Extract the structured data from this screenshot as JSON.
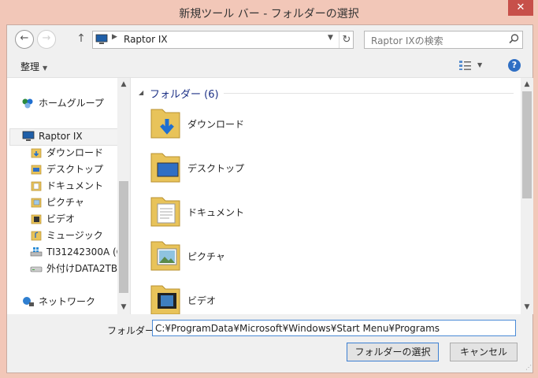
{
  "window": {
    "title": "新規ツール バー - フォルダーの選択",
    "close_label": "✕"
  },
  "nav": {
    "back_label": "←",
    "forward_label": "→",
    "up_label": "↑",
    "address": "Raptor IX",
    "search_placeholder": "Raptor IXの検索"
  },
  "toolbar": {
    "organize_label": "整理"
  },
  "sidebar": {
    "homegroup": "ホームグループ",
    "computer": "Raptor IX",
    "items": [
      "ダウンロード",
      "デスクトップ",
      "ドキュメント",
      "ピクチャ",
      "ビデオ",
      "ミュージック",
      "TI31242300A (C",
      "外付けDATA2TB"
    ],
    "network": "ネットワーク"
  },
  "content": {
    "group_label": "フォルダー (6)",
    "items": [
      "ダウンロード",
      "デスクトップ",
      "ドキュメント",
      "ピクチャ",
      "ビデオ"
    ]
  },
  "bottom": {
    "folder_label": "フォルダー:",
    "folder_value": "C:¥ProgramData¥Microsoft¥Windows¥Start Menu¥Programs",
    "select_button": "フォルダーの選択",
    "cancel_button": "キャンセル"
  },
  "colors": {
    "titlebar": "#f2c7b8",
    "close": "#c7504a",
    "group_header": "#1e3287",
    "accent": "#3c7fd2"
  }
}
